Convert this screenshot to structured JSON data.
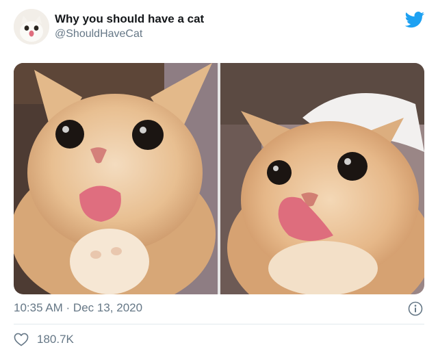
{
  "tweet": {
    "display_name": "Why you should have a cat",
    "handle": "@ShouldHaveCat",
    "timestamp": "10:35 AM · Dec 13, 2020",
    "likes": "180.7K"
  },
  "icons": {
    "brand": "twitter-bird-icon",
    "info": "info-icon",
    "like": "heart-icon"
  },
  "colors": {
    "brand_blue": "#1da1f2",
    "secondary_text": "#657786",
    "divider": "#e1e8ed"
  }
}
